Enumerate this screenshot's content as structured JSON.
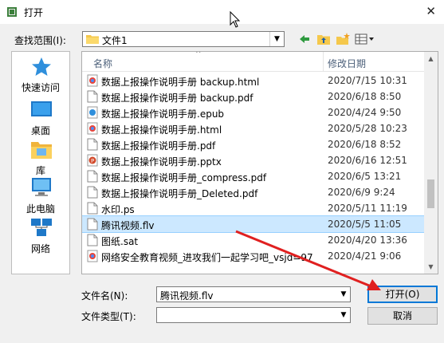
{
  "window": {
    "title": "打开"
  },
  "lookin": {
    "label": "查找范围(I):",
    "value": "文件1"
  },
  "places": [
    {
      "label": "快速访问",
      "icon": "star-icon"
    },
    {
      "label": "桌面",
      "icon": "desktop-icon"
    },
    {
      "label": "库",
      "icon": "library-icon"
    },
    {
      "label": "此电脑",
      "icon": "computer-icon"
    },
    {
      "label": "网络",
      "icon": "network-icon"
    }
  ],
  "columns": {
    "name": "名称",
    "date": "修改日期"
  },
  "files": [
    {
      "name": "数据上报操作说明手册 backup.html",
      "date": "2020/7/15 10:31",
      "icon": "html"
    },
    {
      "name": "数据上报操作说明手册 backup.pdf",
      "date": "2020/6/18 8:50",
      "icon": "doc"
    },
    {
      "name": "数据上报操作说明手册.epub",
      "date": "2020/4/24 9:50",
      "icon": "epub"
    },
    {
      "name": "数据上报操作说明手册.html",
      "date": "2020/5/28 10:23",
      "icon": "html"
    },
    {
      "name": "数据上报操作说明手册.pdf",
      "date": "2020/6/18 8:52",
      "icon": "doc"
    },
    {
      "name": "数据上报操作说明手册.pptx",
      "date": "2020/6/16 12:51",
      "icon": "pptx"
    },
    {
      "name": "数据上报操作说明手册_compress.pdf",
      "date": "2020/6/5 13:21",
      "icon": "doc"
    },
    {
      "name": "数据上报操作说明手册_Deleted.pdf",
      "date": "2020/6/9 9:24",
      "icon": "doc"
    },
    {
      "name": "水印.ps",
      "date": "2020/5/11 11:19",
      "icon": "doc"
    },
    {
      "name": "腾讯视频.flv",
      "date": "2020/5/5 11:05",
      "icon": "doc",
      "selected": true
    },
    {
      "name": "图纸.sat",
      "date": "2020/4/20 13:36",
      "icon": "doc"
    },
    {
      "name": "网络安全教育视频_进攻我们一起学习吧_vsjd=97",
      "date": "2020/4/21 9:06",
      "icon": "html"
    }
  ],
  "filename": {
    "label": "文件名(N):",
    "value": "腾讯视频.flv"
  },
  "filetype": {
    "label": "文件类型(T):",
    "value": ""
  },
  "buttons": {
    "open": "打开(O)",
    "cancel": "取消"
  },
  "colors": {
    "selection": "#cce8ff",
    "accent": "#0078d7",
    "arrow": "#e02020"
  }
}
